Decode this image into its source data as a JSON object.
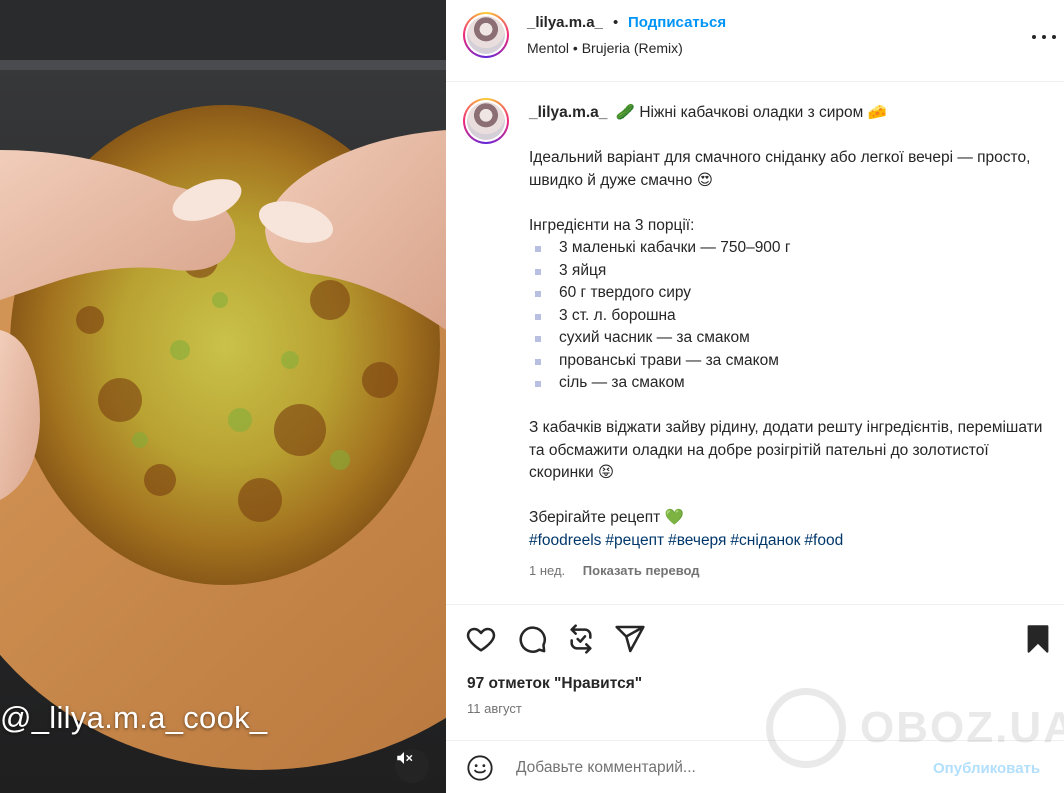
{
  "media": {
    "overlay_text": "@_lilya.m.a_cook_",
    "mute_icon": "speaker-muted-icon"
  },
  "header": {
    "username": "_lilya.m.a_",
    "separator": "•",
    "follow_label": "Подписаться",
    "music": "Mentol • Brujeria (Remix)",
    "more_icon": "more-dots-icon"
  },
  "caption": {
    "username": "_lilya.m.a_",
    "title": "🥒 Ніжні кабачкові оладки з сиром 🧀",
    "intro": "Ідеальний варіант для смачного сніданку або легкої вечері — просто, швидко й дуже смачно 😍",
    "ingredients_heading": "Інгредієнти на 3 порції:",
    "ingredients": [
      "3 маленькі кабачки — 750–900 г",
      "3 яйця",
      "60 г твердого сиру",
      "3 ст. л. борошна",
      "сухий часник — за смаком",
      "прованські трави — за смаком",
      "сіль — за смаком"
    ],
    "method": "З кабачків віджати зайву рідину, додати решту інгредієнтів, перемішати та обсмажити оладки на добре розігрітій пательні до золотистої скоринки 😝",
    "save_note": "Зберігайте рецепт 💚",
    "hashtags": [
      "#foodreels",
      "#рецепт",
      "#вечеря",
      "#сніданок",
      "#food"
    ]
  },
  "meta": {
    "time_ago": "1 нед.",
    "translate_label": "Показать перевод"
  },
  "actions": {
    "like_icon": "heart-icon",
    "comment_icon": "comment-icon",
    "repost_icon": "repost-icon",
    "share_icon": "share-icon",
    "save_icon": "bookmark-icon"
  },
  "likes_text": "97 отметок \"Нравится\"",
  "date_text": "11 август",
  "comment": {
    "placeholder": "Добавьте комментарий...",
    "publish_label": "Опубликовать"
  },
  "watermark": {
    "text": "OBOZ.UA"
  },
  "colors": {
    "accent": "#0095f6",
    "hashtag": "#00376b",
    "muted": "#737373",
    "publish_disabled": "#b2dffc",
    "bullet": "#b8bfe0"
  }
}
